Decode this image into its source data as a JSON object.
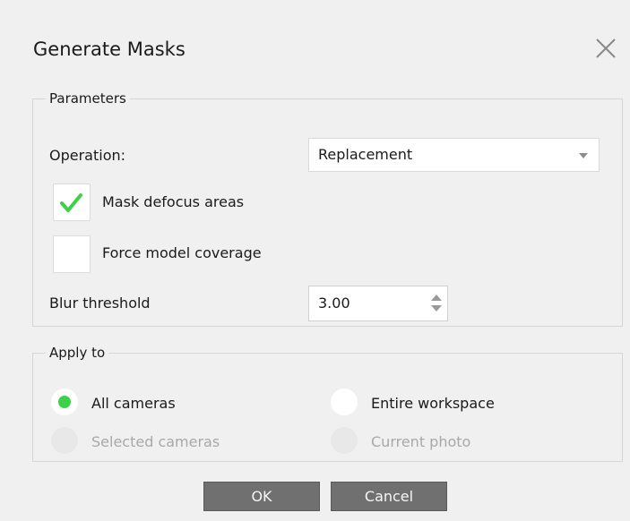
{
  "dialog": {
    "title": "Generate Masks",
    "close_icon": "close-icon"
  },
  "parameters": {
    "legend": "Parameters",
    "operation_label": "Operation:",
    "operation_value": "Replacement",
    "mask_defocus_label": "Mask defocus areas",
    "mask_defocus_checked": true,
    "force_coverage_label": "Force model coverage",
    "force_coverage_checked": false,
    "blur_threshold_label": "Blur threshold",
    "blur_threshold_value": "3.00"
  },
  "apply_to": {
    "legend": "Apply to",
    "options": [
      {
        "label": "All cameras",
        "selected": true,
        "enabled": true
      },
      {
        "label": "Entire workspace",
        "selected": false,
        "enabled": true
      },
      {
        "label": "Selected cameras",
        "selected": false,
        "enabled": false
      },
      {
        "label": "Current photo",
        "selected": false,
        "enabled": false
      }
    ]
  },
  "buttons": {
    "ok_label": "OK",
    "cancel_label": "Cancel"
  },
  "colors": {
    "accent_green": "#3dd14a",
    "button_gray": "#707070",
    "background": "#f0f0f0"
  }
}
